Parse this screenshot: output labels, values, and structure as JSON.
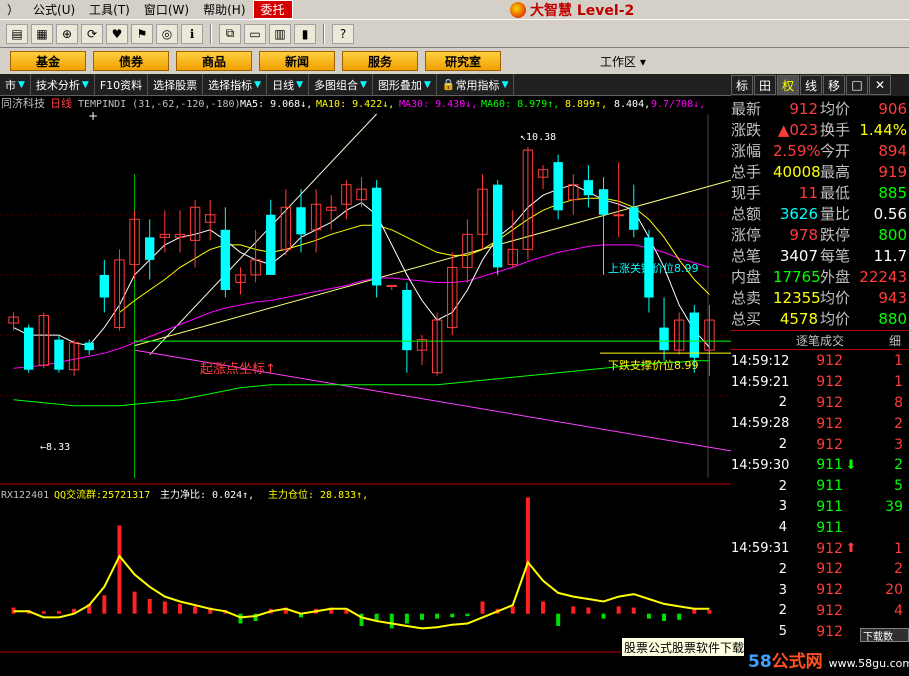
{
  "menubar": {
    "items": [
      "）",
      "公式(U)",
      "工具(T)",
      "窗口(W)",
      "帮助(H)",
      "委托"
    ],
    "brand": "大智慧 Level-2"
  },
  "nav": {
    "buttons": [
      "基金",
      "债券",
      "商品",
      "新闻",
      "服务",
      "研究室"
    ],
    "workspace": "工作区"
  },
  "dtool": {
    "items": [
      "市",
      "技术分析",
      "F10资料",
      "选择股票",
      "选择指标",
      "日线",
      "多图组合",
      "图形叠加",
      "常用指标"
    ]
  },
  "rtabs": [
    "标",
    "田",
    "权",
    "线",
    "移",
    "□",
    "✕"
  ],
  "indicator_bar": {
    "name": "同济科技",
    "period": "日线",
    "tmp": "TEMPINDI (31,-62,-120,-180)",
    "ma5": "MA5: 9.068↓,",
    "ma10": "MA10: 9.422↓,",
    "ma30": "MA30: 9.430↓,",
    "ma60": "MA60: 8.979↑,",
    "extra1": "8.899↑,",
    "extra2": "8.404,",
    "extra3": "9.7/708↓,"
  },
  "sub_indicator": {
    "name": "RX122401",
    "qq": "QQ交流群:25721317",
    "net": "主力净比: 0.024↑,",
    "pos": "主力仓位: 28.833↑,"
  },
  "annotations": {
    "high": "10.38",
    "low": "8.33",
    "start": "起涨点坐标↑",
    "resist": "上涨关键价位8.99",
    "support": "下跌支撑价位8.99",
    "plus": "+"
  },
  "quote": [
    {
      "l1": "最新",
      "v1": "912",
      "c1": "red",
      "l2": "均价",
      "v2": "906",
      "c2": "red"
    },
    {
      "l1": "涨跌",
      "v1": "▲023",
      "c1": "red",
      "l2": "换手",
      "v2": "1.44%",
      "c2": "yel"
    },
    {
      "l1": "涨幅",
      "v1": "2.59%",
      "c1": "red",
      "l2": "今开",
      "v2": "894",
      "c2": "red"
    },
    {
      "l1": "总手",
      "v1": "40008",
      "c1": "yel",
      "l2": "最高",
      "v2": "919",
      "c2": "red"
    },
    {
      "l1": "现手",
      "v1": "11",
      "c1": "red",
      "l2": "最低",
      "v2": "885",
      "c2": "green"
    },
    {
      "l1": "总额",
      "v1": "3626",
      "c1": "cyan",
      "l2": "量比",
      "v2": "0.56",
      "c2": "white"
    },
    {
      "l1": "涨停",
      "v1": "978",
      "c1": "red",
      "l2": "跌停",
      "v2": "800",
      "c2": "green"
    },
    {
      "l1": "总笔",
      "v1": "3407",
      "c1": "white",
      "l2": "每笔",
      "v2": "11.7",
      "c2": "white"
    },
    {
      "l1": "内盘",
      "v1": "17765",
      "c1": "green",
      "l2": "外盘",
      "v2": "22243",
      "c2": "red"
    },
    {
      "l1": "总卖",
      "v1": "12355",
      "c1": "yel",
      "l2": "均价",
      "v2": "943",
      "c2": "red"
    },
    {
      "l1": "总买",
      "v1": "4578",
      "c1": "yel",
      "l2": "均价",
      "v2": "880",
      "c2": "green"
    }
  ],
  "tick_header": {
    "title": "逐笔成交",
    "fine": "细"
  },
  "ticks": [
    {
      "time": "14:59:12",
      "price": "912",
      "arrow": "",
      "vol": "1",
      "vc": "red"
    },
    {
      "time": "14:59:21",
      "price": "912",
      "arrow": "",
      "vol": "1",
      "vc": "red"
    },
    {
      "time": "",
      "price": "912",
      "arrow": "",
      "vol": "8",
      "vc": "red",
      "left": "2"
    },
    {
      "time": "14:59:28",
      "price": "912",
      "arrow": "",
      "vol": "2",
      "vc": "red"
    },
    {
      "time": "",
      "price": "912",
      "arrow": "",
      "vol": "3",
      "vc": "red",
      "left": "2"
    },
    {
      "time": "14:59:30",
      "price": "911",
      "arrow": "down",
      "vol": "2",
      "vc": "green"
    },
    {
      "time": "",
      "price": "911",
      "arrow": "",
      "vol": "5",
      "vc": "green",
      "left": "2"
    },
    {
      "time": "",
      "price": "911",
      "arrow": "",
      "vol": "39",
      "vc": "green",
      "left": "3"
    },
    {
      "time": "",
      "price": "911",
      "arrow": "",
      "vol": "",
      "vc": "green",
      "left": "4"
    },
    {
      "time": "14:59:31",
      "price": "912",
      "arrow": "up",
      "vol": "1",
      "vc": "red"
    },
    {
      "time": "",
      "price": "912",
      "arrow": "",
      "vol": "2",
      "vc": "red",
      "left": "2"
    },
    {
      "time": "",
      "price": "912",
      "arrow": "",
      "vol": "20",
      "vc": "red",
      "left": "3"
    },
    {
      "time": "",
      "price": "912",
      "arrow": "",
      "vol": "4",
      "vc": "red",
      "left": "2"
    },
    {
      "time": "",
      "price": "912",
      "arrow": "",
      "vol": "",
      "vc": "red",
      "left": "5"
    }
  ],
  "ad": "股票公式股票软件下载",
  "float_btn": "下载数",
  "watermark": {
    "a": "58",
    "b": "公式网",
    "url": "www.58gu.com"
  },
  "colors": {
    "up": "#ff3c3c",
    "down": "#00ffff",
    "ma5": "#ffffff",
    "ma10": "#ffff00",
    "ma30": "#ff00ff",
    "ma60": "#00ff00"
  },
  "chart_data": {
    "type": "candlestick",
    "candles": [
      [
        9.23,
        9.27,
        9.18,
        9.3
      ],
      [
        9.2,
        8.92,
        8.9,
        9.22
      ],
      [
        8.95,
        9.28,
        8.93,
        9.3
      ],
      [
        9.12,
        8.92,
        8.9,
        9.15
      ],
      [
        8.92,
        9.1,
        8.88,
        9.12
      ],
      [
        9.1,
        9.05,
        9.02,
        9.12
      ],
      [
        9.55,
        9.4,
        9.3,
        9.65
      ],
      [
        9.2,
        9.65,
        9.18,
        9.72
      ],
      [
        9.62,
        9.92,
        9.52,
        9.98
      ],
      [
        9.8,
        9.65,
        9.52,
        9.92
      ],
      [
        9.8,
        9.82,
        9.7,
        9.98
      ],
      [
        9.8,
        9.82,
        9.7,
        9.98
      ],
      [
        9.78,
        10.0,
        9.6,
        10.05
      ],
      [
        9.9,
        9.95,
        9.78,
        10.05
      ],
      [
        9.85,
        9.45,
        9.4,
        10.0
      ],
      [
        9.5,
        9.55,
        9.42,
        9.6
      ],
      [
        9.55,
        9.65,
        9.5,
        9.85
      ],
      [
        9.95,
        9.55,
        9.55,
        10.05
      ],
      [
        9.72,
        10.0,
        9.68,
        10.12
      ],
      [
        10.0,
        9.82,
        9.7,
        10.12
      ],
      [
        9.85,
        10.02,
        9.7,
        10.12
      ],
      [
        9.98,
        10.0,
        9.85,
        10.08
      ],
      [
        10.02,
        10.15,
        9.92,
        10.18
      ],
      [
        10.05,
        10.12,
        10.0,
        10.2
      ],
      [
        10.13,
        9.48,
        9.4,
        10.18
      ],
      [
        9.48,
        9.48,
        9.45,
        9.48
      ],
      [
        9.45,
        9.05,
        8.9,
        9.5
      ],
      [
        9.05,
        9.12,
        8.95,
        9.15
      ],
      [
        8.9,
        9.25,
        8.88,
        9.3
      ],
      [
        9.2,
        9.6,
        9.15,
        9.7
      ],
      [
        9.6,
        9.82,
        9.5,
        9.92
      ],
      [
        9.82,
        10.12,
        9.72,
        10.22
      ],
      [
        10.15,
        9.6,
        9.55,
        10.18
      ],
      [
        9.62,
        9.72,
        9.6,
        9.98
      ],
      [
        9.72,
        10.38,
        9.65,
        10.4
      ],
      [
        10.2,
        10.25,
        10.12,
        10.28
      ],
      [
        10.3,
        9.98,
        9.92,
        10.35
      ],
      [
        10.05,
        10.15,
        9.95,
        10.22
      ],
      [
        10.18,
        10.08,
        10.0,
        10.28
      ],
      [
        10.12,
        9.95,
        9.55,
        10.2
      ],
      [
        9.95,
        9.95,
        9.8,
        10.3
      ],
      [
        10.0,
        9.85,
        9.8,
        10.15
      ],
      [
        9.8,
        9.4,
        9.3,
        9.85
      ],
      [
        9.2,
        9.05,
        8.98,
        9.4
      ],
      [
        9.05,
        9.25,
        9.02,
        9.3
      ],
      [
        9.3,
        9.0,
        8.9,
        9.35
      ],
      [
        9.05,
        9.25,
        8.88,
        9.35
      ]
    ],
    "ma5": [
      9.2,
      9.15,
      9.15,
      9.15,
      9.1,
      9.08,
      9.2,
      9.35,
      9.55,
      9.65,
      9.75,
      9.8,
      9.82,
      9.85,
      9.78,
      9.7,
      9.65,
      9.62,
      9.7,
      9.8,
      9.85,
      9.9,
      9.98,
      10.03,
      9.95,
      9.75,
      9.55,
      9.38,
      9.25,
      9.3,
      9.45,
      9.65,
      9.8,
      9.88,
      10.0,
      10.08,
      10.12,
      10.15,
      10.1,
      10.05,
      10.02,
      9.98,
      9.8,
      9.6,
      9.35,
      9.18,
      9.07
    ],
    "ma10": [
      null,
      null,
      null,
      null,
      null,
      null,
      null,
      9.3,
      9.38,
      9.45,
      9.52,
      9.6,
      9.66,
      9.72,
      9.75,
      9.75,
      9.72,
      9.7,
      9.72,
      9.75,
      9.78,
      9.82,
      9.85,
      9.88,
      9.88,
      9.85,
      9.8,
      9.75,
      9.7,
      9.68,
      9.68,
      9.72,
      9.78,
      9.85,
      9.92,
      9.98,
      10.02,
      10.05,
      10.06,
      10.06,
      10.04,
      10.0,
      9.92,
      9.8,
      9.65,
      9.52,
      9.42
    ],
    "ma30": [
      8.93,
      8.94,
      8.95,
      8.97,
      8.99,
      9.01,
      9.03,
      9.06,
      9.1,
      9.14,
      9.18,
      9.22,
      9.26,
      9.3,
      9.33,
      9.35,
      9.37,
      9.38,
      9.4,
      9.42,
      9.44,
      9.46,
      9.48,
      9.51,
      9.53,
      9.53,
      9.52,
      9.51,
      9.5,
      9.5,
      9.51,
      9.54,
      9.57,
      9.6,
      9.64,
      9.67,
      9.7,
      9.72,
      9.74,
      9.75,
      9.75,
      9.75,
      9.73,
      9.7,
      9.66,
      9.63,
      9.6
    ],
    "ma60": [
      8.72,
      8.71,
      8.7,
      8.69,
      8.68,
      8.68,
      8.68,
      8.68,
      8.69,
      8.7,
      8.71,
      8.72,
      8.74,
      8.76,
      8.78,
      8.8,
      8.81,
      8.82,
      8.82,
      8.82,
      8.82,
      8.82,
      8.82,
      8.82,
      8.82,
      8.82,
      8.82,
      8.82,
      8.82,
      8.83,
      8.84,
      8.85,
      8.86,
      8.87,
      8.88,
      8.89,
      8.9,
      8.91,
      8.92,
      8.93,
      8.94,
      8.95,
      8.96,
      8.97,
      8.97,
      8.98,
      8.98
    ],
    "ymin": 8.2,
    "ymax": 10.62,
    "levels": [
      8.99
    ],
    "sub_values": [
      0.1,
      0.1,
      0.05,
      0.05,
      0.08,
      0.15,
      0.3,
      0.55,
      0.4,
      0.3,
      0.22,
      0.18,
      0.15,
      0.12,
      0.1,
      0.05,
      0.06,
      0.1,
      0.12,
      0.08,
      0.1,
      0.12,
      0.12,
      0.05,
      0.02,
      0.0,
      -0.02,
      -0.04,
      -0.03,
      -0.01,
      0.0,
      0.05,
      0.1,
      0.15,
      0.5,
      0.35,
      0.25,
      0.22,
      0.2,
      0.18,
      0.22,
      0.24,
      0.2,
      0.16,
      0.14,
      0.12,
      0.12
    ],
    "sub_bars": [
      0.05,
      0.03,
      0.02,
      0.02,
      0.04,
      0.08,
      0.15,
      0.72,
      0.18,
      0.12,
      0.1,
      0.08,
      0.06,
      0.05,
      0.03,
      -0.08,
      -0.06,
      0.04,
      0.05,
      -0.03,
      0.04,
      0.05,
      0.04,
      -0.1,
      -0.05,
      -0.12,
      -0.08,
      -0.05,
      -0.04,
      -0.03,
      -0.02,
      0.1,
      0.04,
      0.06,
      0.95,
      0.1,
      -0.1,
      0.06,
      0.05,
      -0.04,
      0.06,
      0.05,
      -0.04,
      -0.06,
      -0.05,
      0.04,
      0.03
    ],
    "sub_ymin": -0.2,
    "sub_ymax": 1.0
  }
}
